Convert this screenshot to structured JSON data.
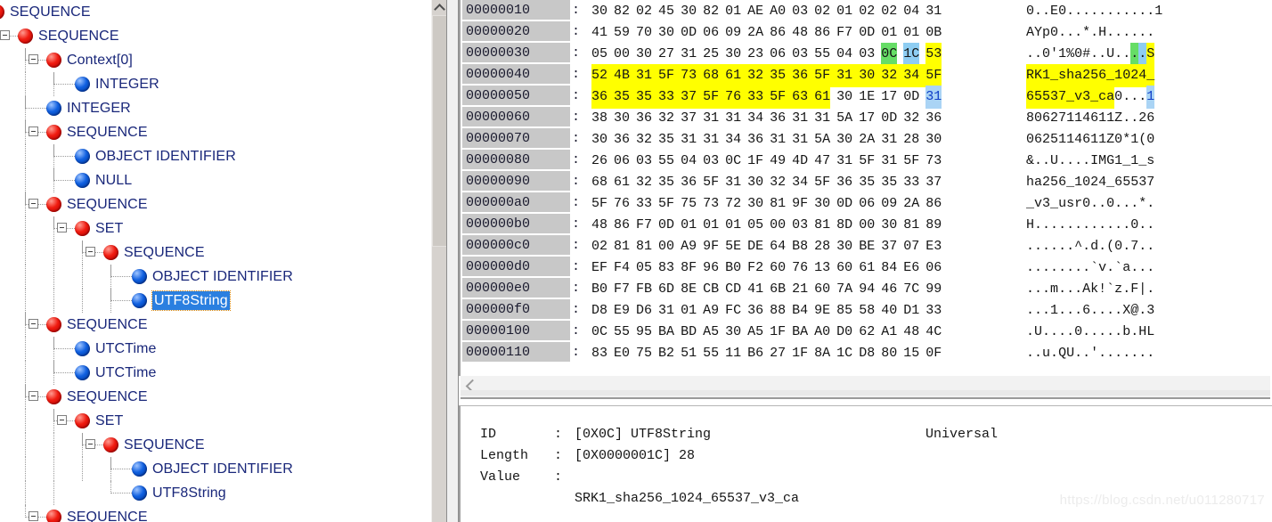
{
  "tree": {
    "name": "asn1-structure-tree",
    "selected_label": "UTF8String",
    "rows": [
      {
        "label": "SEQUENCE",
        "depth": 0,
        "kind": "red",
        "expander": false,
        "selected": false
      },
      {
        "label": "SEQUENCE",
        "depth": 1,
        "kind": "red",
        "expander": true,
        "selected": false
      },
      {
        "label": "Context[0]",
        "depth": 2,
        "kind": "red",
        "expander": true,
        "selected": false
      },
      {
        "label": "INTEGER",
        "depth": 3,
        "kind": "blue",
        "expander": false,
        "selected": false
      },
      {
        "label": "INTEGER",
        "depth": 2,
        "kind": "blue",
        "expander": false,
        "selected": false
      },
      {
        "label": "SEQUENCE",
        "depth": 2,
        "kind": "red",
        "expander": true,
        "selected": false
      },
      {
        "label": "OBJECT IDENTIFIER",
        "depth": 3,
        "kind": "blue",
        "expander": false,
        "selected": false
      },
      {
        "label": "NULL",
        "depth": 3,
        "kind": "blue",
        "expander": false,
        "selected": false
      },
      {
        "label": "SEQUENCE",
        "depth": 2,
        "kind": "red",
        "expander": true,
        "selected": false
      },
      {
        "label": "SET",
        "depth": 3,
        "kind": "red",
        "expander": true,
        "selected": false
      },
      {
        "label": "SEQUENCE",
        "depth": 4,
        "kind": "red",
        "expander": true,
        "selected": false
      },
      {
        "label": "OBJECT IDENTIFIER",
        "depth": 5,
        "kind": "blue",
        "expander": false,
        "selected": false
      },
      {
        "label": "UTF8String",
        "depth": 5,
        "kind": "blue",
        "expander": false,
        "selected": true
      },
      {
        "label": "SEQUENCE",
        "depth": 2,
        "kind": "red",
        "expander": true,
        "selected": false
      },
      {
        "label": "UTCTime",
        "depth": 3,
        "kind": "blue",
        "expander": false,
        "selected": false
      },
      {
        "label": "UTCTime",
        "depth": 3,
        "kind": "blue",
        "expander": false,
        "selected": false
      },
      {
        "label": "SEQUENCE",
        "depth": 2,
        "kind": "red",
        "expander": true,
        "selected": false
      },
      {
        "label": "SET",
        "depth": 3,
        "kind": "red",
        "expander": true,
        "selected": false
      },
      {
        "label": "SEQUENCE",
        "depth": 4,
        "kind": "red",
        "expander": true,
        "selected": false
      },
      {
        "label": "OBJECT IDENTIFIER",
        "depth": 5,
        "kind": "blue",
        "expander": false,
        "selected": false
      },
      {
        "label": "UTF8String",
        "depth": 5,
        "kind": "blue",
        "expander": false,
        "selected": false
      },
      {
        "label": "SEQUENCE",
        "depth": 2,
        "kind": "red",
        "expander": true,
        "selected": false
      }
    ]
  },
  "hex": {
    "name": "hex-dump-view",
    "separator": ":",
    "rows": [
      {
        "offset": "00000010",
        "bytes": [
          "30",
          "82",
          "02",
          "45",
          "30",
          "82",
          "01",
          "AE",
          "A0",
          "03",
          "02",
          "01",
          "02",
          "02",
          "04",
          "31"
        ],
        "byte_hl": [
          "",
          "",
          "",
          "",
          "",
          "",
          "",
          "",
          "",
          "",
          "",
          "",
          "",
          "",
          "",
          ""
        ],
        "ascii": "0..E0...........1",
        "ascii_hl": []
      },
      {
        "offset": "00000020",
        "bytes": [
          "41",
          "59",
          "70",
          "30",
          "0D",
          "06",
          "09",
          "2A",
          "86",
          "48",
          "86",
          "F7",
          "0D",
          "01",
          "01",
          "0B"
        ],
        "byte_hl": [
          "",
          "",
          "",
          "",
          "",
          "",
          "",
          "",
          "",
          "",
          "",
          "",
          "",
          "",
          "",
          ""
        ],
        "ascii": "AYp0...*.H......",
        "ascii_hl": []
      },
      {
        "offset": "00000030",
        "bytes": [
          "05",
          "00",
          "30",
          "27",
          "31",
          "25",
          "30",
          "23",
          "06",
          "03",
          "55",
          "04",
          "03",
          "0C",
          "1C",
          "53"
        ],
        "byte_hl": [
          "",
          "",
          "",
          "",
          "",
          "",
          "",
          "",
          "",
          "",
          "",
          "",
          "",
          "g",
          "c",
          "y"
        ],
        "ascii": "..0'1%0#..U....S",
        "ascii_hl": [
          {
            "index": 13,
            "color": "g"
          },
          {
            "index": 14,
            "color": "c"
          },
          {
            "index": 15,
            "color": "y"
          }
        ]
      },
      {
        "offset": "00000040",
        "bytes": [
          "52",
          "4B",
          "31",
          "5F",
          "73",
          "68",
          "61",
          "32",
          "35",
          "36",
          "5F",
          "31",
          "30",
          "32",
          "34",
          "5F"
        ],
        "byte_hl": [
          "y",
          "y",
          "y",
          "y",
          "y",
          "y",
          "y",
          "y",
          "y",
          "y",
          "y",
          "y",
          "y",
          "y",
          "y",
          "y"
        ],
        "ascii": "RK1_sha256_1024_",
        "ascii_hl": [
          {
            "index": 0,
            "color": "y"
          },
          {
            "index": 1,
            "color": "y"
          },
          {
            "index": 2,
            "color": "y"
          },
          {
            "index": 3,
            "color": "y"
          },
          {
            "index": 4,
            "color": "y"
          },
          {
            "index": 5,
            "color": "y"
          },
          {
            "index": 6,
            "color": "y"
          },
          {
            "index": 7,
            "color": "y"
          },
          {
            "index": 8,
            "color": "y"
          },
          {
            "index": 9,
            "color": "y"
          },
          {
            "index": 10,
            "color": "y"
          },
          {
            "index": 11,
            "color": "y"
          },
          {
            "index": 12,
            "color": "y"
          },
          {
            "index": 13,
            "color": "y"
          },
          {
            "index": 14,
            "color": "y"
          },
          {
            "index": 15,
            "color": "y"
          }
        ]
      },
      {
        "offset": "00000050",
        "bytes": [
          "36",
          "35",
          "35",
          "33",
          "37",
          "5F",
          "76",
          "33",
          "5F",
          "63",
          "61",
          "30",
          "1E",
          "17",
          "0D",
          "31"
        ],
        "byte_hl": [
          "y",
          "y",
          "y",
          "y",
          "y",
          "y",
          "y",
          "y",
          "y",
          "y",
          "y",
          "",
          "",
          "",
          "",
          "b"
        ],
        "ascii": "65537_v3_ca0...1",
        "ascii_hl": [
          {
            "index": 0,
            "color": "y"
          },
          {
            "index": 1,
            "color": "y"
          },
          {
            "index": 2,
            "color": "y"
          },
          {
            "index": 3,
            "color": "y"
          },
          {
            "index": 4,
            "color": "y"
          },
          {
            "index": 5,
            "color": "y"
          },
          {
            "index": 6,
            "color": "y"
          },
          {
            "index": 7,
            "color": "y"
          },
          {
            "index": 8,
            "color": "y"
          },
          {
            "index": 9,
            "color": "y"
          },
          {
            "index": 10,
            "color": "y"
          },
          {
            "index": 15,
            "color": "b"
          }
        ]
      },
      {
        "offset": "00000060",
        "bytes": [
          "38",
          "30",
          "36",
          "32",
          "37",
          "31",
          "31",
          "34",
          "36",
          "31",
          "31",
          "5A",
          "17",
          "0D",
          "32",
          "36"
        ],
        "byte_hl": [
          "",
          "",
          "",
          "",
          "",
          "",
          "",
          "",
          "",
          "",
          "",
          "",
          "",
          "",
          "",
          ""
        ],
        "ascii": "80627114611Z..26",
        "ascii_hl": []
      },
      {
        "offset": "00000070",
        "bytes": [
          "30",
          "36",
          "32",
          "35",
          "31",
          "31",
          "34",
          "36",
          "31",
          "31",
          "5A",
          "30",
          "2A",
          "31",
          "28",
          "30"
        ],
        "byte_hl": [
          "",
          "",
          "",
          "",
          "",
          "",
          "",
          "",
          "",
          "",
          "",
          "",
          "",
          "",
          "",
          ""
        ],
        "ascii": "0625114611Z0*1(0",
        "ascii_hl": []
      },
      {
        "offset": "00000080",
        "bytes": [
          "26",
          "06",
          "03",
          "55",
          "04",
          "03",
          "0C",
          "1F",
          "49",
          "4D",
          "47",
          "31",
          "5F",
          "31",
          "5F",
          "73"
        ],
        "byte_hl": [
          "",
          "",
          "",
          "",
          "",
          "",
          "",
          "",
          "",
          "",
          "",
          "",
          "",
          "",
          "",
          ""
        ],
        "ascii": "&..U....IMG1_1_s",
        "ascii_hl": []
      },
      {
        "offset": "00000090",
        "bytes": [
          "68",
          "61",
          "32",
          "35",
          "36",
          "5F",
          "31",
          "30",
          "32",
          "34",
          "5F",
          "36",
          "35",
          "35",
          "33",
          "37"
        ],
        "byte_hl": [
          "",
          "",
          "",
          "",
          "",
          "",
          "",
          "",
          "",
          "",
          "",
          "",
          "",
          "",
          "",
          ""
        ],
        "ascii": "ha256_1024_65537",
        "ascii_hl": []
      },
      {
        "offset": "000000a0",
        "bytes": [
          "5F",
          "76",
          "33",
          "5F",
          "75",
          "73",
          "72",
          "30",
          "81",
          "9F",
          "30",
          "0D",
          "06",
          "09",
          "2A",
          "86"
        ],
        "byte_hl": [
          "",
          "",
          "",
          "",
          "",
          "",
          "",
          "",
          "",
          "",
          "",
          "",
          "",
          "",
          "",
          ""
        ],
        "ascii": "_v3_usr0..0...*.",
        "ascii_hl": []
      },
      {
        "offset": "000000b0",
        "bytes": [
          "48",
          "86",
          "F7",
          "0D",
          "01",
          "01",
          "01",
          "05",
          "00",
          "03",
          "81",
          "8D",
          "00",
          "30",
          "81",
          "89"
        ],
        "byte_hl": [
          "",
          "",
          "",
          "",
          "",
          "",
          "",
          "",
          "",
          "",
          "",
          "",
          "",
          "",
          "",
          ""
        ],
        "ascii": "H............0..",
        "ascii_hl": []
      },
      {
        "offset": "000000c0",
        "bytes": [
          "02",
          "81",
          "81",
          "00",
          "A9",
          "9F",
          "5E",
          "DE",
          "64",
          "B8",
          "28",
          "30",
          "BE",
          "37",
          "07",
          "E3"
        ],
        "byte_hl": [
          "",
          "",
          "",
          "",
          "",
          "",
          "",
          "",
          "",
          "",
          "",
          "",
          "",
          "",
          "",
          ""
        ],
        "ascii": "......^.d.(0.7..",
        "ascii_hl": []
      },
      {
        "offset": "000000d0",
        "bytes": [
          "EF",
          "F4",
          "05",
          "83",
          "8F",
          "96",
          "B0",
          "F2",
          "60",
          "76",
          "13",
          "60",
          "61",
          "84",
          "E6",
          "06"
        ],
        "byte_hl": [
          "",
          "",
          "",
          "",
          "",
          "",
          "",
          "",
          "",
          "",
          "",
          "",
          "",
          "",
          "",
          ""
        ],
        "ascii": "........`v.`a...",
        "ascii_hl": []
      },
      {
        "offset": "000000e0",
        "bytes": [
          "B0",
          "F7",
          "FB",
          "6D",
          "8E",
          "CB",
          "CD",
          "41",
          "6B",
          "21",
          "60",
          "7A",
          "94",
          "46",
          "7C",
          "99"
        ],
        "byte_hl": [
          "",
          "",
          "",
          "",
          "",
          "",
          "",
          "",
          "",
          "",
          "",
          "",
          "",
          "",
          "",
          ""
        ],
        "ascii": "...m...Ak!`z.F|.",
        "ascii_hl": []
      },
      {
        "offset": "000000f0",
        "bytes": [
          "D8",
          "E9",
          "D6",
          "31",
          "01",
          "A9",
          "FC",
          "36",
          "88",
          "B4",
          "9E",
          "85",
          "58",
          "40",
          "D1",
          "33"
        ],
        "byte_hl": [
          "",
          "",
          "",
          "",
          "",
          "",
          "",
          "",
          "",
          "",
          "",
          "",
          "",
          "",
          "",
          ""
        ],
        "ascii": "...1...6....X@.3",
        "ascii_hl": []
      },
      {
        "offset": "00000100",
        "bytes": [
          "0C",
          "55",
          "95",
          "BA",
          "BD",
          "A5",
          "30",
          "A5",
          "1F",
          "BA",
          "A0",
          "D0",
          "62",
          "A1",
          "48",
          "4C"
        ],
        "byte_hl": [
          "",
          "",
          "",
          "",
          "",
          "",
          "",
          "",
          "",
          "",
          "",
          "",
          "",
          "",
          "",
          ""
        ],
        "ascii": ".U....0.....b.HL",
        "ascii_hl": []
      },
      {
        "offset": "00000110",
        "bytes": [
          "83",
          "E0",
          "75",
          "B2",
          "51",
          "55",
          "11",
          "B6",
          "27",
          "1F",
          "8A",
          "1C",
          "D8",
          "80",
          "15",
          "0F"
        ],
        "byte_hl": [
          "",
          "",
          "",
          "",
          "",
          "",
          "",
          "",
          "",
          "",
          "",
          "",
          "",
          "",
          "",
          ""
        ],
        "ascii": "..u.QU..'.......",
        "ascii_hl": []
      }
    ]
  },
  "detail": {
    "name": "node-detail-panel",
    "id_key": "ID",
    "id_value": "[0X0C] UTF8String",
    "id_class": "Universal",
    "length_key": "Length",
    "length_value": "[0X0000001C] 28",
    "value_key": "Value",
    "value_text": "SRK1_sha256_1024_65537_v3_ca",
    "colon": ":"
  },
  "watermark": {
    "text": "https://blog.csdn.net/u011280717"
  },
  "colors": {
    "highlight_yellow": "#ffff00",
    "highlight_green": "#66dd66",
    "highlight_cyan": "#8ecdf2",
    "highlight_blue": "#aad4f5",
    "selection_blue": "#2a7fe0",
    "tree_text": "#19277a",
    "offset_bg": "#c8c8c8"
  }
}
